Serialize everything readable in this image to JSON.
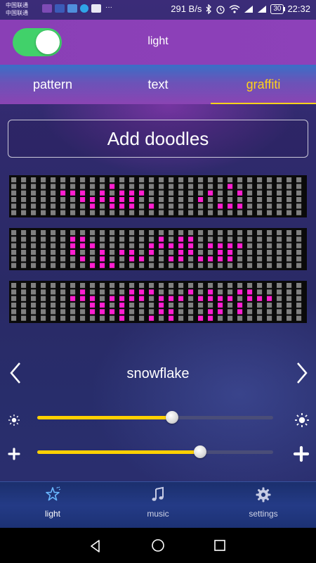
{
  "status_bar": {
    "carrier_1": "中国联通",
    "carrier_2": "中国联通",
    "network_speed": "291 B/s",
    "battery": "30",
    "time": "22:32"
  },
  "header": {
    "title": "light",
    "power_toggle_on": true
  },
  "tabs": [
    {
      "label": "pattern",
      "active": false
    },
    {
      "label": "text",
      "active": false
    },
    {
      "label": "graffiti",
      "active": true
    }
  ],
  "add_doodles_label": "Add doodles",
  "pattern_name": "snowflake",
  "sliders": {
    "brightness": {
      "icon": "sun-icon",
      "value": 0.57
    },
    "speed": {
      "icon": "plus-icon",
      "value": 0.69
    }
  },
  "bottom_nav": [
    {
      "label": "light",
      "icon": "star-hand-icon",
      "active": true
    },
    {
      "label": "music",
      "icon": "music-note-icon",
      "active": false
    },
    {
      "label": "settings",
      "icon": "gear-icon",
      "active": false
    }
  ],
  "colors": {
    "accent": "#ffd21a",
    "led_on": "#ff1fd0",
    "led_off": "#808080",
    "toggle_on": "#41d16a"
  },
  "matrices": [
    {
      "rows": [
        "000000000000000000000000000000",
        "000000000010000000000010000000",
        "000001110101110000001001000000",
        "000000011111100000010000000000",
        "000000001011101000000111000000",
        "000000000000000000000000000000"
      ]
    },
    {
      "rows": [
        "000000000000000000000000000000",
        "000000110000000101100000000000",
        "000000111000001111101111000000",
        "000000100101101001100110000000",
        "000000010100110011011110000000",
        "000000001110000000000000000000"
      ]
    },
    {
      "rows": [
        "000000000000000000000000000000",
        "000000010000111000101001100000",
        "000000111011110111011110111000",
        "000000001101000100000101000000",
        "000000001111000110001101000000",
        "000000000001001010011000000000"
      ]
    }
  ]
}
